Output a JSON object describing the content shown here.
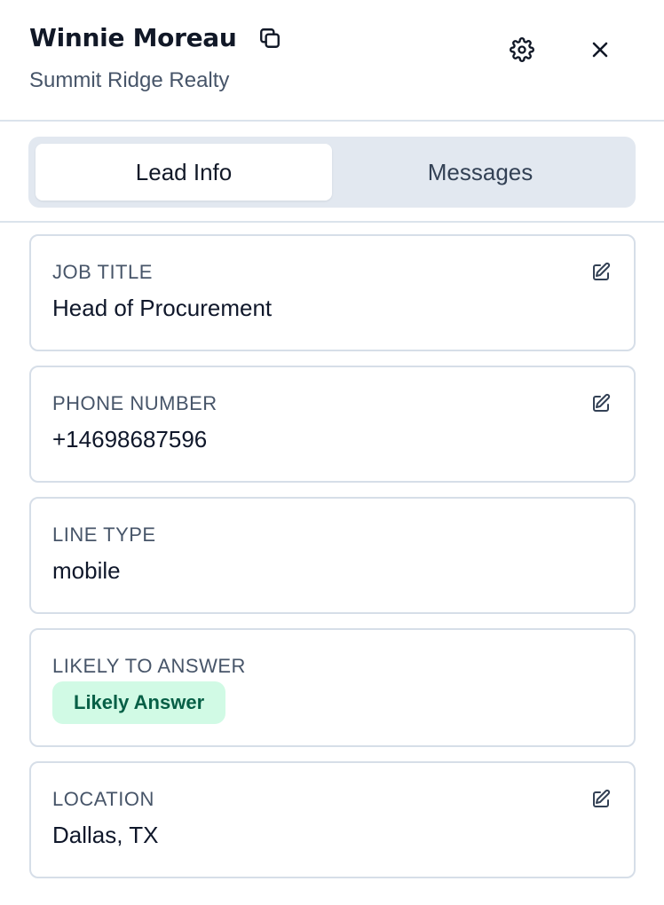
{
  "header": {
    "lead_name": "Winnie Moreau",
    "company": "Summit Ridge Realty"
  },
  "tabs": [
    {
      "label": "Lead Info",
      "active": true
    },
    {
      "label": "Messages",
      "active": false
    }
  ],
  "fields": {
    "job_title": {
      "label": "JOB TITLE",
      "value": "Head of Procurement"
    },
    "phone_number": {
      "label": "PHONE NUMBER",
      "value": "+14698687596"
    },
    "line_type": {
      "label": "LINE TYPE",
      "value": "mobile"
    },
    "likely_to_answer": {
      "label": "LIKELY TO ANSWER",
      "badge": "Likely Answer"
    },
    "location": {
      "label": "LOCATION",
      "value": "Dallas, TX"
    }
  },
  "colors": {
    "badge_bg": "#d1fae5",
    "badge_text": "#065f46",
    "tab_track": "#e2e8f0",
    "border": "#d6dee8"
  },
  "icons": [
    "copy-icon",
    "gear-icon",
    "close-icon",
    "edit-icon"
  ]
}
